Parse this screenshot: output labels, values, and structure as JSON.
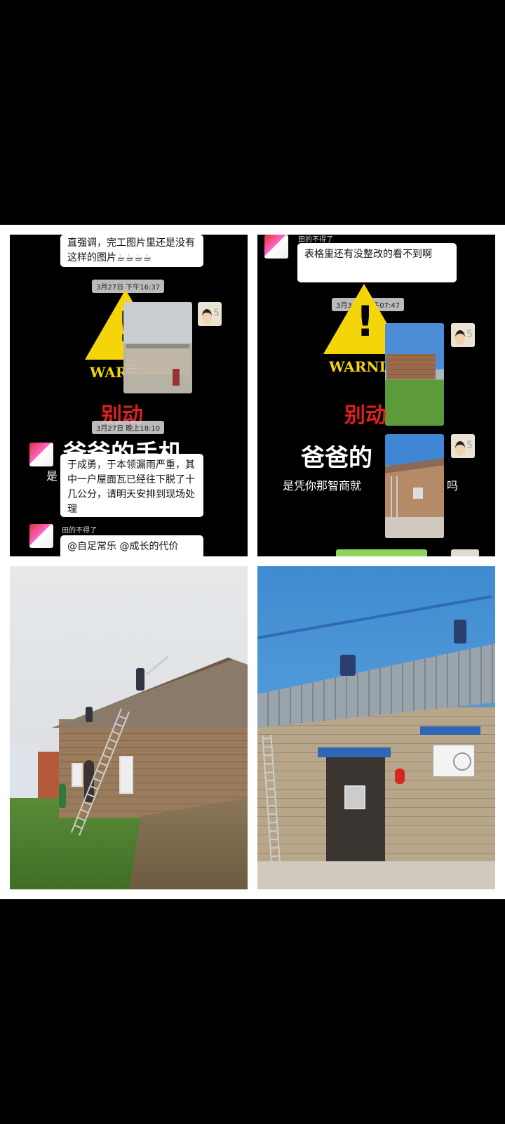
{
  "panel_tl": {
    "msg_top": "直强调，完工图片里还是没有这样的图片☕☕☕☕",
    "time1": "3月27日 下午16:37",
    "warning": "WARNING",
    "bie": "别动",
    "time2": "3月27日 晚上18:10",
    "baba": "爸爸的手机",
    "msg_mid": "于成勇，于本领漏雨严重，其中一户屋面瓦已经往下脱了十几公分，请明天安排到现场处理",
    "sender": "田的不得了",
    "msg_bottom": "@自足常乐 @成长的代价"
  },
  "panel_tr": {
    "sender": "田的不得了",
    "msg_top": "表格里还有没整改的看不到啊",
    "time1": "3月30日 上午07:47",
    "warning": "WARNI",
    "bie": "别动",
    "baba": "爸爸的",
    "sub": "是凭你那智商就",
    "sub_tail": "吗"
  },
  "icons": {
    "avatar_left": "avatar-icon",
    "avatar_right": "avatar-icon",
    "warning_triangle": "warning-icon"
  }
}
